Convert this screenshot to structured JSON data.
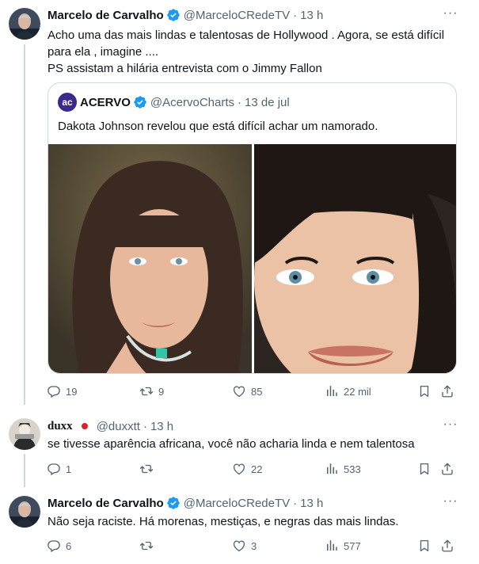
{
  "tweet1": {
    "author_name": "Marcelo de Carvalho",
    "handle": "@MarceloCRedeTV",
    "time": "13 h",
    "text_lines": [
      "Acho uma das mais lindas e talentosas de Hollywood . Agora, se está difícil",
      "para ela , imagine ....",
      "PS assistam a hilária entrevista com o Jimmy Fallon"
    ],
    "quote": {
      "author_name": "ACERVO",
      "handle": "@AcervoCharts",
      "date": "13 de jul",
      "avatar_text": "ac",
      "text": "Dakota Johnson revelou que está difícil achar um namorado."
    },
    "actions": {
      "replies": "19",
      "retweets": "9",
      "likes": "85",
      "views": "22 mil"
    }
  },
  "tweet2": {
    "author_name": "duxx",
    "flag": "jp-flag",
    "handle": "@duxxtt",
    "time": "13 h",
    "text": "se tivesse aparência africana, você não acharia linda e nem talentosa",
    "actions": {
      "replies": "1",
      "retweets": "",
      "likes": "22",
      "views": "533"
    }
  },
  "tweet3": {
    "author_name": "Marcelo de Carvalho",
    "handle": "@MarceloCRedeTV",
    "time": "13 h",
    "text": "Não seja raciste. Há morenas, mestiças, e negras das mais lindas.",
    "actions": {
      "replies": "6",
      "retweets": "",
      "likes": "3",
      "views": "577"
    }
  },
  "separator": "·",
  "colors": {
    "verified": "#1d9bf0",
    "muted": "#536471",
    "border": "#cfd9de",
    "text": "#0f1419"
  }
}
